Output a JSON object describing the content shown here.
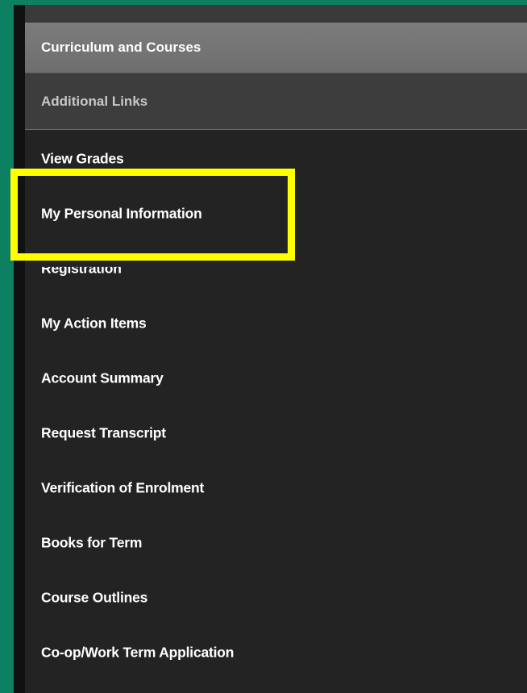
{
  "menu": {
    "header_primary": "Curriculum and Courses",
    "header_secondary": "Additional Links",
    "items": [
      {
        "label": "View Grades"
      },
      {
        "label": "My Personal Information"
      },
      {
        "label": "Registration"
      },
      {
        "label": "My Action Items"
      },
      {
        "label": "Account Summary"
      },
      {
        "label": "Request Transcript"
      },
      {
        "label": "Verification of Enrolment"
      },
      {
        "label": "Books for Term"
      },
      {
        "label": "Course Outlines"
      },
      {
        "label": "Co-op/Work Term Application"
      }
    ]
  },
  "colors": {
    "background_green": "#0c8061",
    "panel": "#232323",
    "highlight": "#ffff00"
  }
}
